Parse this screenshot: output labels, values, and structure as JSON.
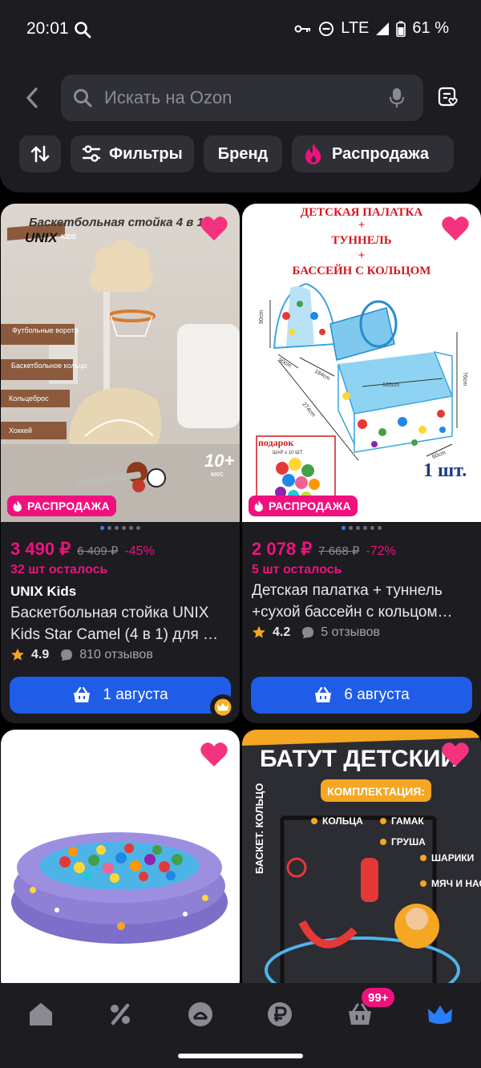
{
  "status_bar": {
    "time": "20:01",
    "network": "LTE",
    "battery": "61 %"
  },
  "header": {
    "search_placeholder": "Искать на Ozon",
    "chips": {
      "filters": "Фильтры",
      "brand": "Бренд",
      "sale": "Распродажа"
    }
  },
  "colors": {
    "accent": "#f1117e",
    "button": "#1f5de8",
    "card": "#1c1c21",
    "surface": "#2f2f36"
  },
  "products": [
    {
      "badge": "РАСПРОДАЖА",
      "price": "3 490 ₽",
      "old_price": "6 409 ₽",
      "discount": "-45%",
      "stock": "32 шт осталось",
      "brand": "UNIX Kids",
      "title_line1": "Баскетбольная стойка UNIX",
      "title_line2": "Kids Star Camel (4 в 1) для …",
      "rating": "4.9",
      "reviews": "810 отзывов",
      "delivery": "1 августа",
      "image_text": {
        "headline": "Баскетбольная стойка 4 в 1",
        "logo": "UNIX",
        "logo_sub": "KIDS",
        "labels": [
          "Футбольные ворота",
          "Баскетбольное кольцо",
          "Кольцеброс",
          "Хоккей"
        ],
        "age": "10+",
        "age_unit": "мес"
      }
    },
    {
      "badge": "РАСПРОДАЖА",
      "price": "2 078 ₽",
      "old_price": "7 668 ₽",
      "discount": "-72%",
      "stock": "5 шт осталось",
      "title_line1": "Детская палатка + туннель",
      "title_line2": "+сухой бассейн с кольцом…",
      "rating": "4.2",
      "reviews": "5 отзывов",
      "delivery": "6 августа",
      "image_text": {
        "line1": "ДЕТСКАЯ ПАЛАТКА",
        "plus": "+",
        "line2": "ТУННЕЛЬ",
        "line3": "БАССЕЙН С КОЛЬЦОМ",
        "gift": "подарок",
        "gift_sub": "ШАР x 10 ШТ.",
        "qty": "1 шт.",
        "dims": [
          "90cm",
          "90cm",
          "184cm",
          "274cm",
          "120cm",
          "76cm",
          "60cm"
        ]
      }
    },
    {
      "image_text": {}
    },
    {
      "image_text": {
        "headline": "БАТУТ ДЕТСКИЙ",
        "subhead": "КОМПЛЕКТАЦИЯ:",
        "side": "БАСКЕТ. КОЛЬЦО",
        "items": [
          "КОЛЬЦА",
          "ГАМАК",
          "ГРУША",
          "ШАРИКИ",
          "МЯЧ И НАСОС"
        ]
      }
    }
  ],
  "bottom_nav": {
    "cart_badge": "99+"
  }
}
